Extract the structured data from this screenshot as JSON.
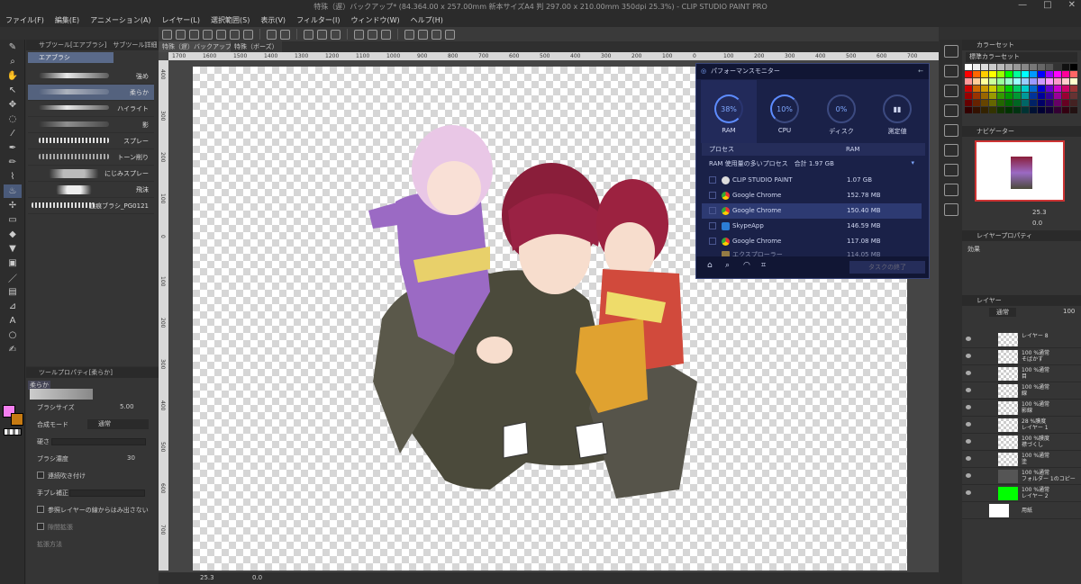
{
  "window": {
    "title": "特殊（遅）バックアップ* (84.364.00 x 257.00mm 新本サイズA4 判 297.00 x 210.00mm 350dpi 25.3%) - CLIP STUDIO PAINT PRO"
  },
  "menu": [
    "ファイル(F)",
    "編集(E)",
    "アニメーション(A)",
    "レイヤー(L)",
    "選択範囲(S)",
    "表示(V)",
    "フィルター(I)",
    "ウィンドウ(W)",
    "ヘルプ(H)"
  ],
  "subtool": {
    "tab1": "サブツール[エアブラシ]",
    "tab2": "サブツール詳細",
    "group": "エアブラシ",
    "brushes": [
      "強め",
      "柔らか",
      "ハイライト",
      "影",
      "スプレー",
      "トーン削り",
      "にじみスプレー",
      "飛沫",
      "血痕ブラシ_PG0121"
    ],
    "selected_index": 1
  },
  "toolprop": {
    "title": "ツールプロパティ[柔らか]",
    "name": "柔らか",
    "size_label": "ブラシサイズ",
    "size_value": "5.00",
    "blend_label": "合成モード",
    "blend_value": "通常",
    "hardness_label": "硬さ",
    "density_label": "ブラシ濃度",
    "density_value": "30",
    "continuous_label": "連続吹き付け",
    "stabilize_label": "手ブレ補正",
    "ref_label": "参照レイヤーの線からはみ出さない",
    "expand_label": "隙間拡張",
    "expand_method_label": "拡張方法"
  },
  "doc": {
    "tab1": "特殊（遅）バックアップ*",
    "tab2": "特殊（ボーズ）"
  },
  "ruler": {
    "ticks": [
      "1700",
      "1600",
      "1500",
      "1400",
      "1300",
      "1200",
      "1100",
      "1000",
      "900",
      "800",
      "700",
      "600",
      "500",
      "400",
      "300",
      "200",
      "100",
      "0",
      "100",
      "200",
      "300",
      "400",
      "500",
      "600",
      "700"
    ],
    "vticks": [
      "400",
      "300",
      "200",
      "100",
      "0",
      "100",
      "200",
      "300",
      "400",
      "500",
      "600",
      "700"
    ]
  },
  "status": {
    "zoom": "25.3",
    "angle": "0.0"
  },
  "perf": {
    "title": "パフォーマンスモニター",
    "gauges": [
      {
        "value": "38%",
        "label": "RAM"
      },
      {
        "value": "10%",
        "label": "CPU"
      },
      {
        "value": "0%",
        "label": "ディスク"
      },
      {
        "value": "",
        "label": "測定値"
      }
    ],
    "col_process": "プロセス",
    "col_ram": "RAM",
    "summary": "RAM 使用量の多いプロセス　合計 1.97 GB",
    "rows": [
      {
        "name": "CLIP STUDIO PAINT",
        "ram": "1.07 GB"
      },
      {
        "name": "Google Chrome",
        "ram": "152.78 MB"
      },
      {
        "name": "Google Chrome",
        "ram": "150.40 MB"
      },
      {
        "name": "SkypeApp",
        "ram": "146.59 MB"
      },
      {
        "name": "Google Chrome",
        "ram": "117.08 MB"
      },
      {
        "name": "エクスプローラー",
        "ram": "114.05 MB"
      }
    ],
    "end_btn": "タスクの終了"
  },
  "colorset": {
    "title": "カラーセット",
    "preset": "標準カラーセット"
  },
  "navigator": {
    "title": "ナビゲーター",
    "zoom": "25.3",
    "angle": "0.0"
  },
  "layerprop": {
    "title": "レイヤープロパティ",
    "effect_label": "効果"
  },
  "layers": {
    "tab": "レイヤー",
    "blend": "通常",
    "opacity": "100",
    "items": [
      {
        "a": "レイヤー 8",
        "b": ""
      },
      {
        "a": "100 %通常",
        "b": "そばかす"
      },
      {
        "a": "100 %通常",
        "b": "目"
      },
      {
        "a": "100 %通常",
        "b": "線"
      },
      {
        "a": "100 %通常",
        "b": "影線"
      },
      {
        "a": "28 %膜度",
        "b": "レイヤー 1"
      },
      {
        "a": "100 %膜度",
        "b": "襟づくし"
      },
      {
        "a": "100 %通常",
        "b": "塗"
      },
      {
        "a": "100 %通常",
        "b": "フォルダー 1のコピー"
      },
      {
        "a": "100 %通常",
        "b": "レイヤー 2"
      },
      {
        "a": "用紙",
        "b": ""
      }
    ]
  }
}
